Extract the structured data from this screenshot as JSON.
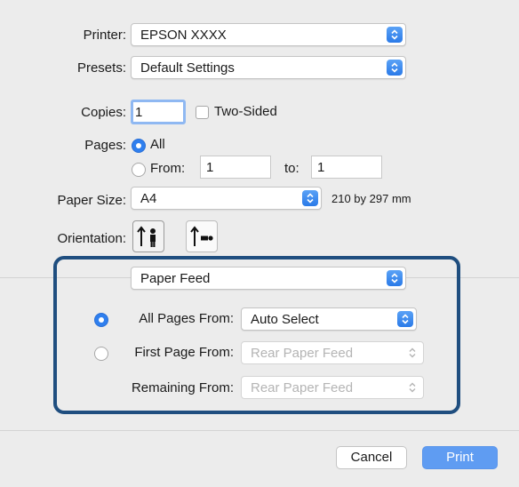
{
  "printer": {
    "label": "Printer:",
    "value": "EPSON XXXX"
  },
  "presets": {
    "label": "Presets:",
    "value": "Default Settings"
  },
  "copies": {
    "label": "Copies:",
    "value": "1",
    "two_sided_label": "Two-Sided",
    "two_sided_checked": false
  },
  "pages": {
    "label": "Pages:",
    "all_label": "All",
    "from_label": "From:",
    "from_value": "1",
    "to_label": "to:",
    "to_value": "1",
    "selected": "All"
  },
  "paper_size": {
    "label": "Paper Size:",
    "value": "A4",
    "dimensions": "210 by 297 mm"
  },
  "orientation": {
    "label": "Orientation:",
    "options": [
      "portrait-icon",
      "landscape-icon"
    ],
    "selected": "portrait"
  },
  "section_menu": {
    "value": "Paper Feed"
  },
  "paper_feed": {
    "all_pages_label": "All Pages From:",
    "all_pages_value": "Auto Select",
    "first_page_label": "First Page From:",
    "first_page_value": "Rear Paper Feed",
    "remaining_label": "Remaining From:",
    "remaining_value": "Rear Paper Feed",
    "selected": "All Pages From"
  },
  "buttons": {
    "cancel": "Cancel",
    "print": "Print"
  },
  "colors": {
    "accent": "#2f7fee",
    "highlight_border": "#1f4e7f",
    "print_button": "#5f9cf2"
  }
}
